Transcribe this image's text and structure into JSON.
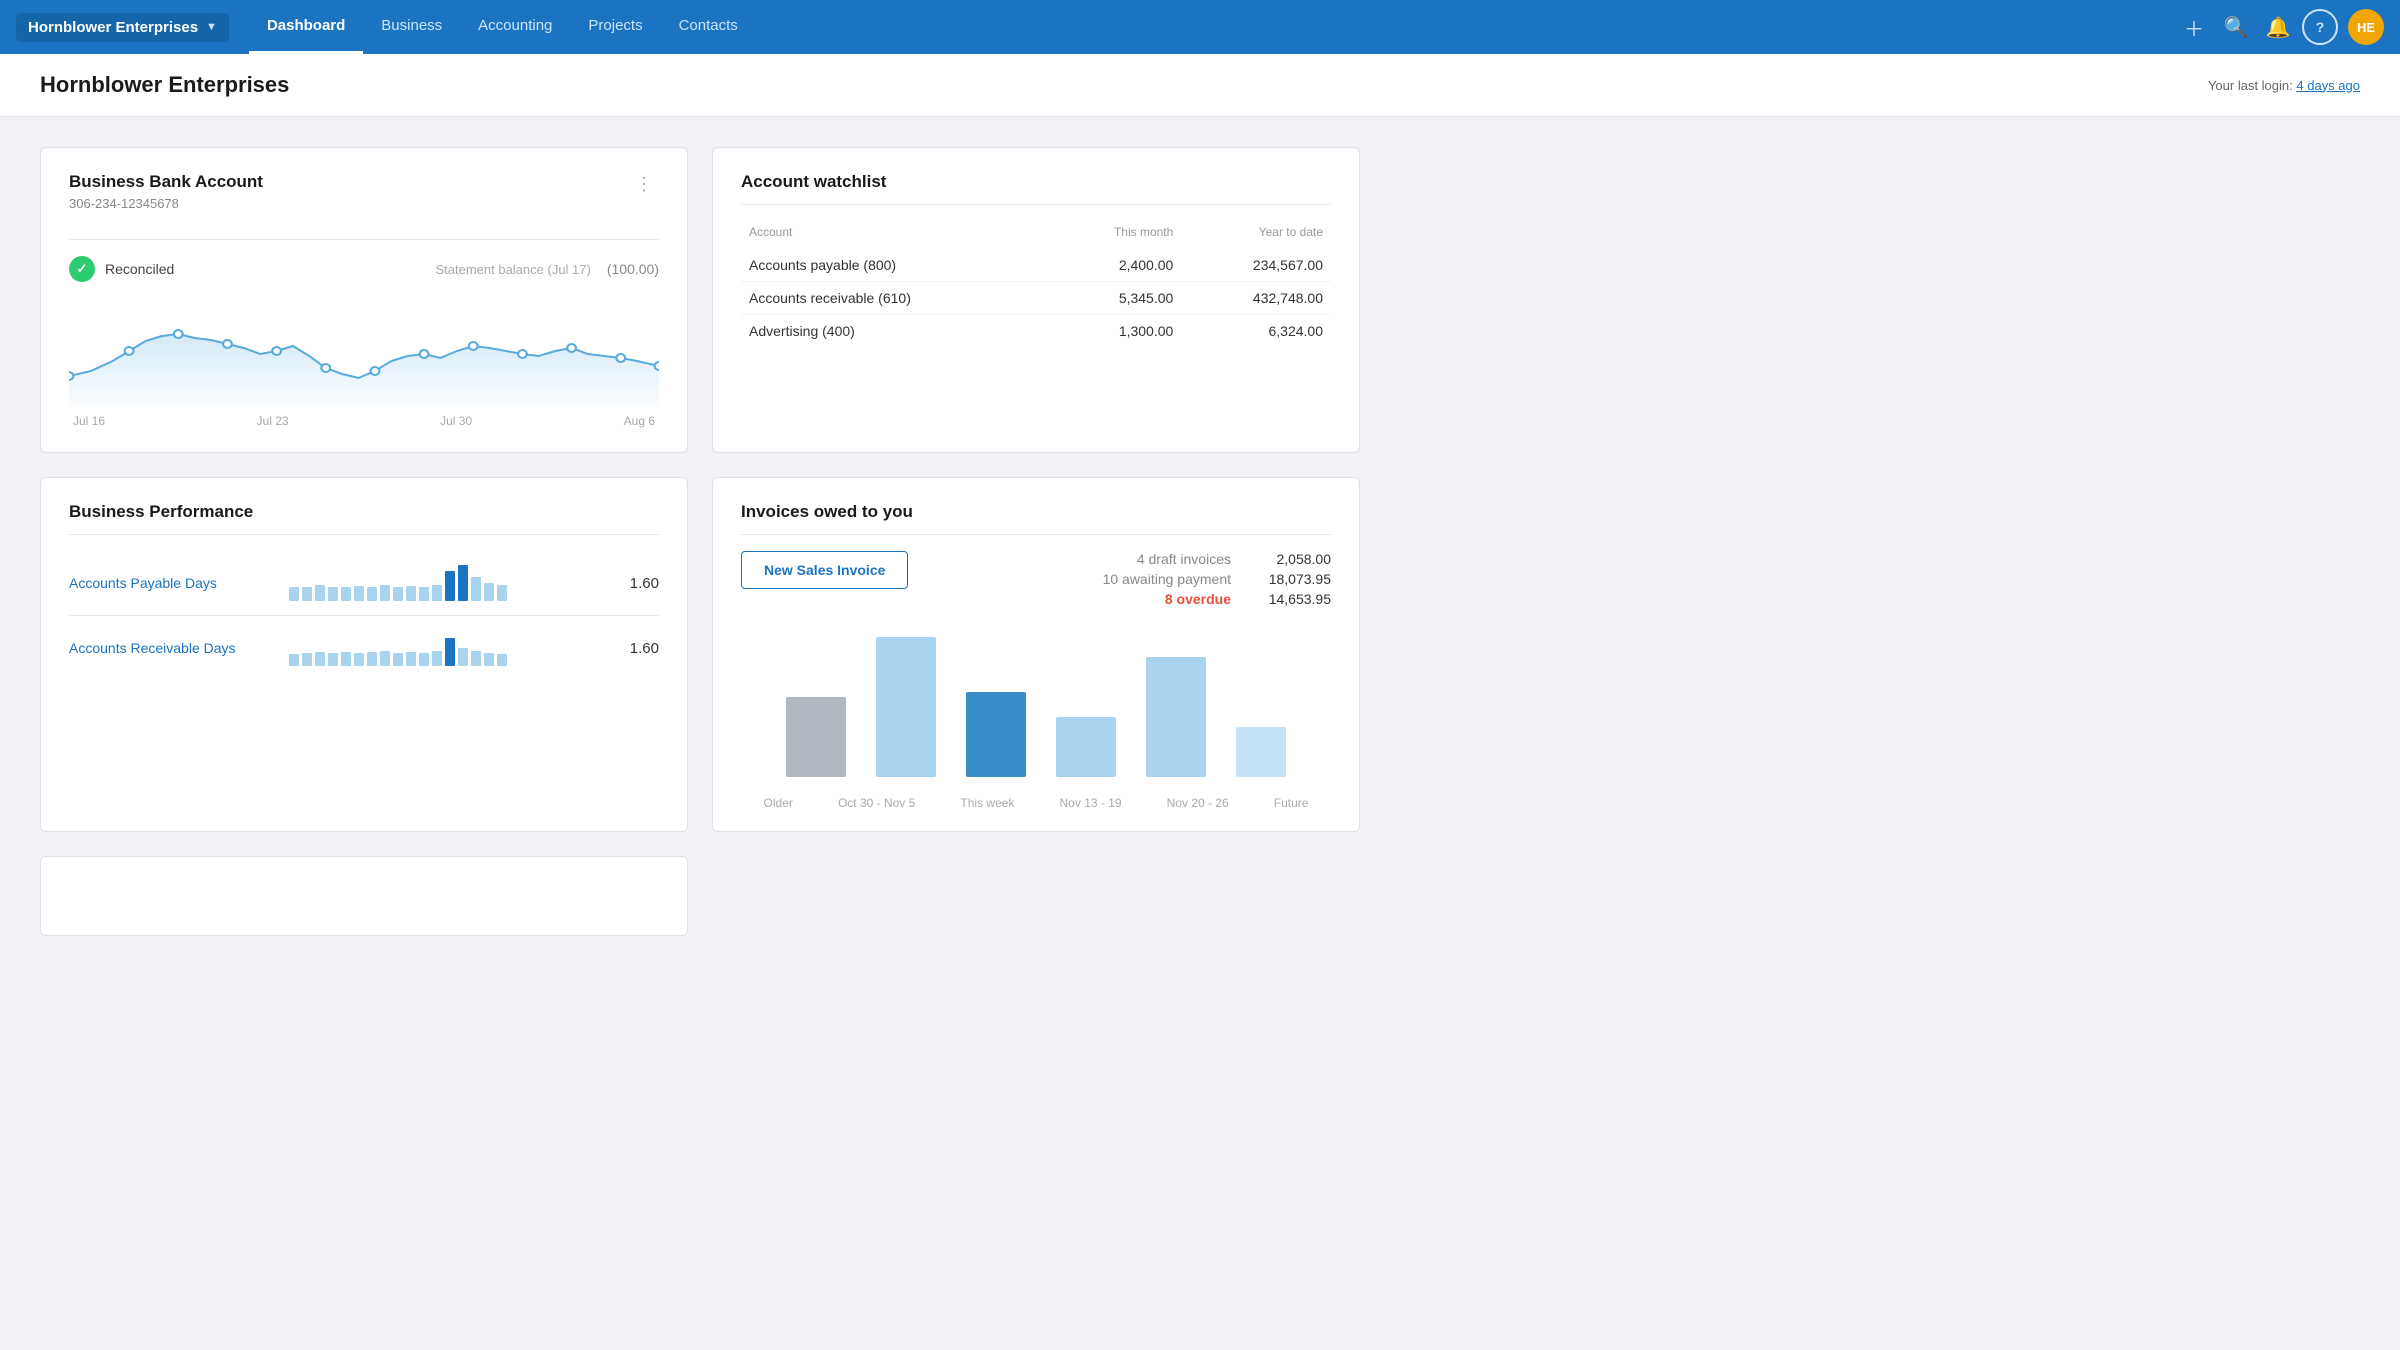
{
  "nav": {
    "brand": "Hornblower Enterprises",
    "links": [
      {
        "label": "Dashboard",
        "active": true
      },
      {
        "label": "Business",
        "active": false
      },
      {
        "label": "Accounting",
        "active": false
      },
      {
        "label": "Projects",
        "active": false
      },
      {
        "label": "Contacts",
        "active": false
      }
    ],
    "avatar_initials": "HE"
  },
  "subheader": {
    "title": "Hornblower Enterprises",
    "last_login_label": "Your last login:",
    "last_login_value": "4 days ago"
  },
  "bank_account": {
    "title": "Business Bank Account",
    "account_number": "306-234-12345678",
    "status": "Reconciled",
    "statement_label": "Statement balance (Jul 17)",
    "statement_balance": "(100.00)",
    "date_labels": [
      "Jul 16",
      "Jul 23",
      "Jul 30",
      "Aug 6"
    ]
  },
  "business_performance": {
    "title": "Business Performance",
    "rows": [
      {
        "label": "Accounts Payable Days",
        "value": "1.60"
      },
      {
        "label": "Accounts Receivable Days",
        "value": "1.60"
      }
    ]
  },
  "account_watchlist": {
    "title": "Account watchlist",
    "columns": [
      "Account",
      "This month",
      "Year to date"
    ],
    "rows": [
      {
        "account": "Accounts payable (800)",
        "this_month": "2,400.00",
        "ytd": "234,567.00"
      },
      {
        "account": "Accounts receivable (610)",
        "this_month": "5,345.00",
        "ytd": "432,748.00"
      },
      {
        "account": "Advertising (400)",
        "this_month": "1,300.00",
        "ytd": "6,324.00"
      }
    ]
  },
  "invoices": {
    "title": "Invoices owed to you",
    "new_invoice_btn": "New Sales Invoice",
    "stats": [
      {
        "label": "4 draft invoices",
        "value": "2,058.00",
        "overdue": false
      },
      {
        "label": "10 awaiting payment",
        "value": "18,073.95",
        "overdue": false
      },
      {
        "label": "8 overdue",
        "value": "14,653.95",
        "overdue": true
      }
    ],
    "bar_labels": [
      "Older",
      "Oct 30 - Nov 5",
      "This week",
      "Nov 13 - 19",
      "Nov 20 - 26",
      "Future"
    ]
  }
}
